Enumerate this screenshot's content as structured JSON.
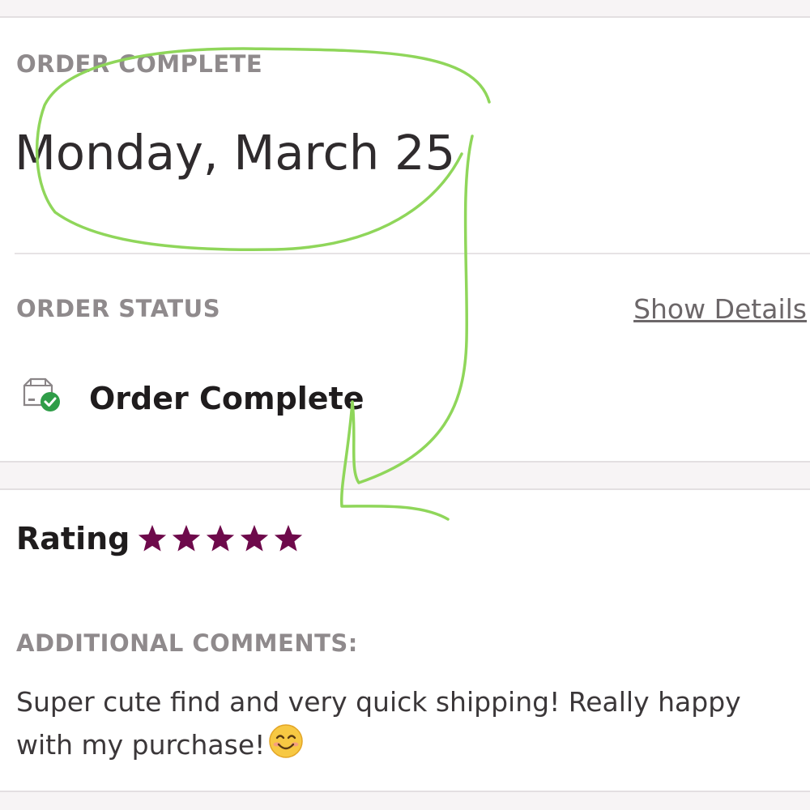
{
  "order": {
    "header_label": "ORDER COMPLETE",
    "date": "Monday, March 25",
    "status_label": "ORDER STATUS",
    "show_details_label": "Show Details",
    "status_text": "Order Complete",
    "status_icon": "box-check-icon"
  },
  "review": {
    "rating_label": "Rating",
    "rating": 5,
    "rating_max": 5,
    "comments_label": "ADDITIONAL COMMENTS:",
    "comment_text": "Super cute find and very quick shipping! Really happy with my purchase!",
    "comment_emoji": "smiling-face-emoji"
  },
  "colors": {
    "star": "#6e0a4b",
    "check_badge": "#2f9d48",
    "annotation": "#8fd65a"
  }
}
